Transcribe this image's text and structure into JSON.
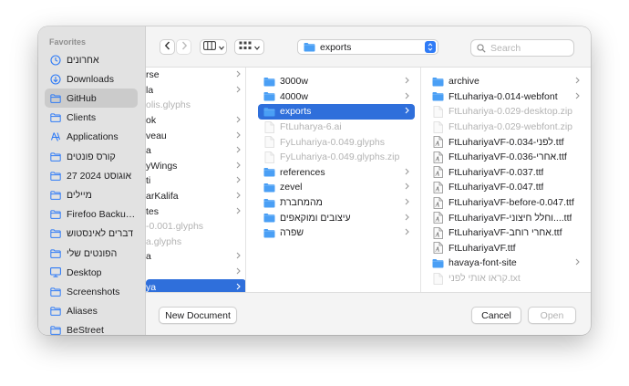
{
  "sidebar": {
    "heading": "Favorites",
    "items": [
      {
        "label": "אחרונים",
        "icon": "clock-icon"
      },
      {
        "label": "Downloads",
        "icon": "download-icon"
      },
      {
        "label": "GitHub",
        "icon": "folder-icon"
      },
      {
        "label": "Clients",
        "icon": "folder-icon"
      },
      {
        "label": "Applications",
        "icon": "applications-icon"
      },
      {
        "label": "קורס פונטים",
        "icon": "folder-icon"
      },
      {
        "label": "27 אוגוסט 2024",
        "icon": "folder-icon"
      },
      {
        "label": "מיילים",
        "icon": "folder-icon"
      },
      {
        "label": "Firefoo Backu…",
        "icon": "folder-icon"
      },
      {
        "label": "דברים לאינסטוש",
        "icon": "folder-icon"
      },
      {
        "label": "הפונטים שלי",
        "icon": "folder-icon"
      },
      {
        "label": "Desktop",
        "icon": "desktop-icon"
      },
      {
        "label": "Screenshots",
        "icon": "folder-icon"
      },
      {
        "label": "Aliases",
        "icon": "folder-icon"
      },
      {
        "label": "BeStreet",
        "icon": "folder-icon"
      }
    ]
  },
  "toolbar": {
    "back_icon": "chevron-left-icon",
    "forward_icon": "chevron-right-icon",
    "view_icon": "column-view-icon",
    "group_icon": "grid-view-icon",
    "path_label": "exports",
    "search_placeholder": "Search"
  },
  "columns": {
    "col1": [
      {
        "label": "rse",
        "chev": true,
        "dim": false,
        "sel": false
      },
      {
        "label": "la",
        "chev": true,
        "dim": false,
        "sel": false
      },
      {
        "label": "olis.glyphs",
        "chev": false,
        "dim": true,
        "sel": false
      },
      {
        "label": "ok",
        "chev": true,
        "dim": false,
        "sel": false
      },
      {
        "label": "veau",
        "chev": true,
        "dim": false,
        "sel": false
      },
      {
        "label": "a",
        "chev": true,
        "dim": false,
        "sel": false
      },
      {
        "label": "yWings",
        "chev": true,
        "dim": false,
        "sel": false
      },
      {
        "label": "ti",
        "chev": true,
        "dim": false,
        "sel": false
      },
      {
        "label": "arKalifa",
        "chev": true,
        "dim": false,
        "sel": false
      },
      {
        "label": "tes",
        "chev": true,
        "dim": false,
        "sel": false
      },
      {
        "label": "-0.001.glyphs",
        "chev": false,
        "dim": true,
        "sel": false
      },
      {
        "label": "a.glyphs",
        "chev": false,
        "dim": true,
        "sel": false
      },
      {
        "label": "a",
        "chev": true,
        "dim": false,
        "sel": false
      },
      {
        "label": "",
        "chev": true,
        "dim": false,
        "sel": false
      },
      {
        "label": "ya",
        "chev": true,
        "dim": false,
        "sel": true
      }
    ],
    "col2": [
      {
        "label": "3000w",
        "icon": "folder",
        "chev": true,
        "dim": false,
        "sel": false
      },
      {
        "label": "4000w",
        "icon": "folder",
        "chev": true,
        "dim": false,
        "sel": false
      },
      {
        "label": "exports",
        "icon": "folder",
        "chev": true,
        "dim": false,
        "sel": true
      },
      {
        "label": "FtLuharya-6.ai",
        "icon": "file",
        "chev": false,
        "dim": true,
        "sel": false
      },
      {
        "label": "FyLuhariya-0.049.glyphs",
        "icon": "file",
        "chev": false,
        "dim": true,
        "sel": false
      },
      {
        "label": "FyLuhariya-0.049.glyphs.zip",
        "icon": "file",
        "chev": false,
        "dim": true,
        "sel": false
      },
      {
        "label": "references",
        "icon": "folder",
        "chev": true,
        "dim": false,
        "sel": false
      },
      {
        "label": "zevel",
        "icon": "folder",
        "chev": true,
        "dim": false,
        "sel": false
      },
      {
        "label": "מהמחברת",
        "icon": "folder",
        "chev": true,
        "dim": false,
        "sel": false
      },
      {
        "label": "עיצובים ומוקאפים",
        "icon": "folder",
        "chev": true,
        "dim": false,
        "sel": false
      },
      {
        "label": "שפרה",
        "icon": "folder",
        "chev": true,
        "dim": false,
        "sel": false
      }
    ],
    "col3": [
      {
        "label": "archive",
        "icon": "folder",
        "chev": true,
        "dim": false
      },
      {
        "label": "FtLuhariya-0.014-webfont",
        "icon": "folder",
        "chev": true,
        "dim": false
      },
      {
        "label": "FtLuhariya-0.029-desktop.zip",
        "icon": "file",
        "chev": false,
        "dim": true
      },
      {
        "label": "FtLuhariya-0.029-webfont.zip",
        "icon": "file",
        "chev": false,
        "dim": true
      },
      {
        "label": "FtLuhariyaVF-0.034-לפני.ttf",
        "icon": "font",
        "chev": false,
        "dim": false
      },
      {
        "label": "FtLuhariyaVF-0.036-אחרי.ttf",
        "icon": "font",
        "chev": false,
        "dim": false
      },
      {
        "label": "FtLuhariyaVF-0.037.ttf",
        "icon": "font",
        "chev": false,
        "dim": false
      },
      {
        "label": "FtLuhariyaVF-0.047.ttf",
        "icon": "font",
        "chev": false,
        "dim": false
      },
      {
        "label": "FtLuhariyaVF-before-0.047.ttf",
        "icon": "font",
        "chev": false,
        "dim": false
      },
      {
        "label": "FtLuhariyaVF-וחלל חיצוני....ttf",
        "icon": "font",
        "chev": false,
        "dim": false
      },
      {
        "label": "FtLuhariyaVF-אחרי רוחב.ttf",
        "icon": "font",
        "chev": false,
        "dim": false
      },
      {
        "label": "FtLuhariyaVF.ttf",
        "icon": "font",
        "chev": false,
        "dim": false
      },
      {
        "label": "havaya-font-site",
        "icon": "folder",
        "chev": true,
        "dim": false
      },
      {
        "label": "קראו אותי לפני.txt",
        "icon": "file",
        "chev": false,
        "dim": true
      }
    ]
  },
  "footer": {
    "new_document": "New Document",
    "cancel": "Cancel",
    "open": "Open"
  },
  "colors": {
    "accent": "#2f6fdb",
    "folder": "#4a9ff5"
  }
}
